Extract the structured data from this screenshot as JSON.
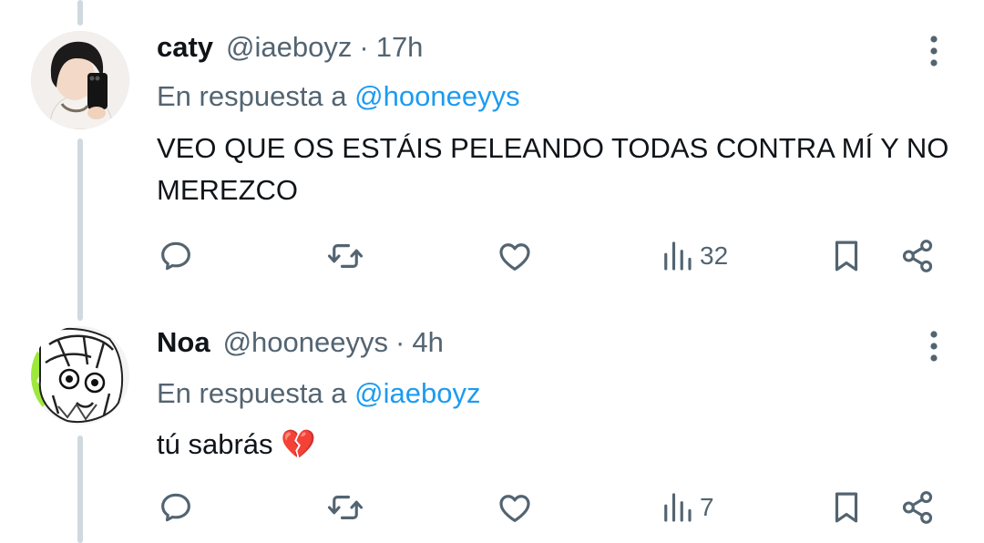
{
  "colors": {
    "text": "#0f1419",
    "muted": "#536471",
    "link": "#1d9bf0",
    "thread_line": "#cfd9de"
  },
  "tweets": [
    {
      "name": "caty",
      "handle": "@iaeboyz",
      "separator": "·",
      "time": "17h",
      "reply_prefix": "En respuesta a",
      "reply_to": "@hooneeyys",
      "text": "VEO QUE OS ESTÁIS PELEANDO TODAS CONTRA MÍ Y NO MEREZCO",
      "views": "32",
      "icons": [
        "reply-icon",
        "retweet-icon",
        "like-icon",
        "views-icon",
        "bookmark-icon",
        "share-icon",
        "more-icon"
      ]
    },
    {
      "name": "Noa",
      "handle": "@hooneeyys",
      "separator": "·",
      "time": "4h",
      "reply_prefix": "En respuesta a",
      "reply_to": "@iaeboyz",
      "text": "tú sabrás 💔",
      "views": "7",
      "icons": [
        "reply-icon",
        "retweet-icon",
        "like-icon",
        "views-icon",
        "bookmark-icon",
        "share-icon",
        "more-icon"
      ]
    }
  ]
}
